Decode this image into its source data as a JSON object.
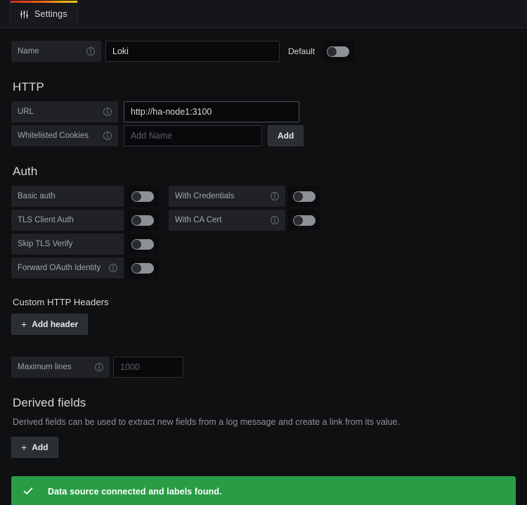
{
  "tabs": [
    {
      "label": "Settings",
      "icon": "sliders-icon",
      "active": true
    }
  ],
  "name_row": {
    "label": "Name",
    "value": "Loki",
    "default_label": "Default",
    "default_toggle": "off"
  },
  "http": {
    "title": "HTTP",
    "url": {
      "label": "URL",
      "value": "http://ha-node1:3100"
    },
    "whitelisted_cookies": {
      "label": "Whitelisted Cookies",
      "placeholder": "Add Name",
      "value": "",
      "add_button": "Add"
    }
  },
  "auth": {
    "title": "Auth",
    "left": [
      {
        "label": "Basic auth",
        "toggle": "off",
        "info": false
      },
      {
        "label": "TLS Client Auth",
        "toggle": "off",
        "info": false
      },
      {
        "label": "Skip TLS Verify",
        "toggle": "off",
        "info": false
      },
      {
        "label": "Forward OAuth Identity",
        "toggle": "off",
        "info": true
      }
    ],
    "right": [
      {
        "label": "With Credentials",
        "toggle": "off",
        "info": true
      },
      {
        "label": "With CA Cert",
        "toggle": "off",
        "info": true
      }
    ]
  },
  "custom_headers": {
    "title": "Custom HTTP Headers",
    "add_button": "Add header"
  },
  "maximum_lines": {
    "label": "Maximum lines",
    "placeholder": "1000",
    "value": ""
  },
  "derived_fields": {
    "title": "Derived fields",
    "description": "Derived fields can be used to extract new fields from a log message and create a link from its value.",
    "add_button": "Add"
  },
  "alert": {
    "icon": "check-icon",
    "message": "Data source connected and labels found.",
    "color": "#299c46"
  },
  "colors": {
    "page_background": "#0f1012",
    "panel_background": "#141619",
    "label_background": "#202226",
    "input_background": "#09090b",
    "accent_gradient_start": "#cc2a26",
    "accent_gradient_end": "#e8c81a",
    "success": "#299c46"
  }
}
